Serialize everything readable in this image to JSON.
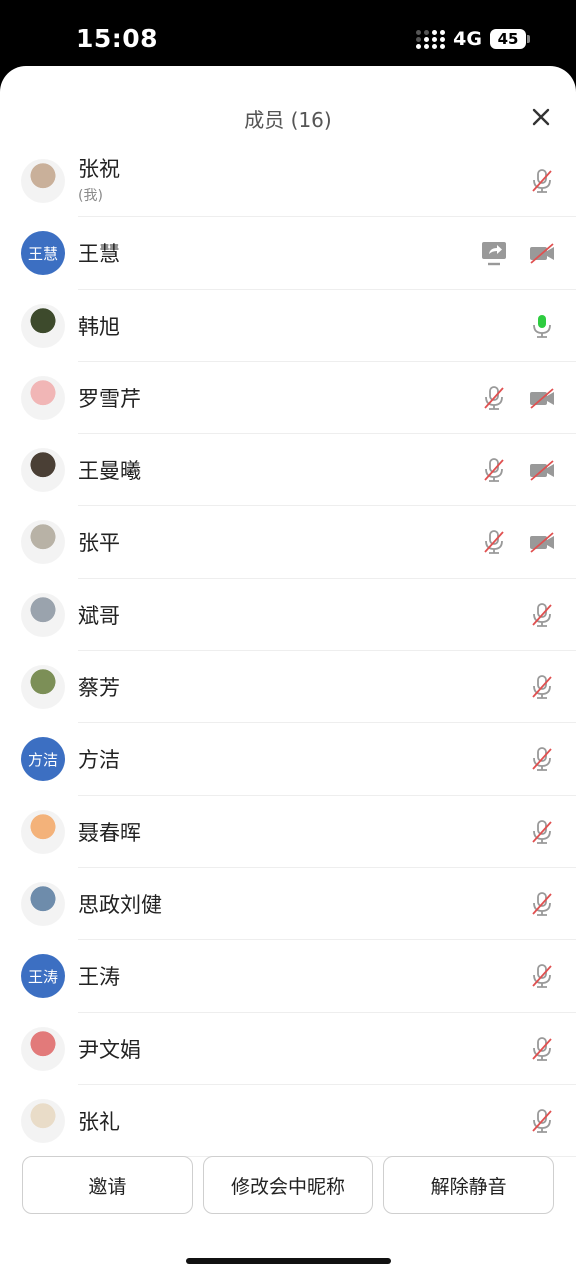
{
  "status_bar": {
    "time": "15:08",
    "network": "4G",
    "battery": "45"
  },
  "header": {
    "title": "成员 (16)",
    "close_icon": "close-icon"
  },
  "members": [
    {
      "name": "张祝",
      "sub": "(我)",
      "avatar": "photo",
      "avatar_color": "#c9b09a",
      "icons": [
        "mic-muted"
      ]
    },
    {
      "name": "王慧",
      "avatar_text": "王慧",
      "avatar": "text",
      "icons": [
        "screen-share",
        "video-off"
      ]
    },
    {
      "name": "韩旭",
      "avatar": "photo",
      "avatar_color": "#3d4a2c",
      "icons": [
        "mic-active"
      ]
    },
    {
      "name": "罗雪芹",
      "avatar": "photo",
      "avatar_color": "#f1b6b6",
      "icons": [
        "mic-muted",
        "video-off"
      ]
    },
    {
      "name": "王曼曦",
      "avatar": "photo",
      "avatar_color": "#4a3f35",
      "icons": [
        "mic-muted",
        "video-off"
      ]
    },
    {
      "name": "张平",
      "avatar": "photo",
      "avatar_color": "#b8b2a6",
      "icons": [
        "mic-muted",
        "video-off"
      ]
    },
    {
      "name": "斌哥",
      "avatar": "photo",
      "avatar_color": "#9aa3ad",
      "icons": [
        "mic-muted"
      ]
    },
    {
      "name": "蔡芳",
      "avatar": "photo",
      "avatar_color": "#7c8f57",
      "icons": [
        "mic-muted"
      ]
    },
    {
      "name": "方洁",
      "avatar_text": "方洁",
      "avatar": "text",
      "icons": [
        "mic-muted"
      ]
    },
    {
      "name": "聂春晖",
      "avatar": "photo",
      "avatar_color": "#f3b27a",
      "icons": [
        "mic-muted"
      ]
    },
    {
      "name": "思政刘健",
      "avatar": "photo",
      "avatar_color": "#6e8cab",
      "icons": [
        "mic-muted"
      ]
    },
    {
      "name": "王涛",
      "avatar_text": "王涛",
      "avatar": "text",
      "icons": [
        "mic-muted"
      ]
    },
    {
      "name": "尹文娟",
      "avatar": "photo",
      "avatar_color": "#e27a7a",
      "icons": [
        "mic-muted"
      ]
    },
    {
      "name": "张礼",
      "avatar": "photo",
      "avatar_color": "#e9dcc8",
      "icons": [
        "mic-muted"
      ]
    }
  ],
  "actions": {
    "invite": "邀请",
    "rename": "修改会中昵称",
    "unmute": "解除静音"
  },
  "colors": {
    "avatar_blue": "#3c6fc2",
    "mic_active": "#2ecc40",
    "muted_slash": "#e05050"
  }
}
